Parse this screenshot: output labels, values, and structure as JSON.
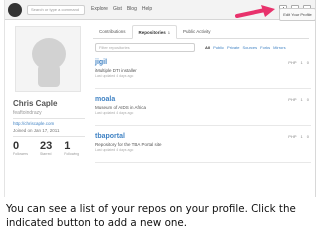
{
  "header": {
    "search_placeholder": "Search or type a command",
    "nav": [
      "Explore",
      "Gist",
      "Blog",
      "Help"
    ],
    "callout_label": "Edit Your Profile"
  },
  "profile": {
    "name": "Chris Caple",
    "username": "feaftoindrazy",
    "website": "http://chriscaple.com",
    "joined": "Joined on Jan 17, 2011",
    "stats": [
      {
        "value": "0",
        "label": "Followers"
      },
      {
        "value": "23",
        "label": "Starred"
      },
      {
        "value": "1",
        "label": "Following"
      }
    ]
  },
  "tabs": [
    {
      "label": "Contributions",
      "count": ""
    },
    {
      "label": "Repositories",
      "count": "1"
    },
    {
      "label": "Public Activity",
      "count": ""
    }
  ],
  "filter": {
    "placeholder": "Filter repositories",
    "types": [
      "All",
      "Public",
      "Private",
      "Sources",
      "Forks",
      "Mirrors"
    ]
  },
  "repos": [
    {
      "name": "jigil",
      "desc": "iMultiple DTI installer",
      "updated": "Last updated 4 days ago",
      "lang": "PHP",
      "stars": "1",
      "forks": "0"
    },
    {
      "name": "moala",
      "desc": "Museum of AIDS in Africa",
      "updated": "Last updated 4 days ago",
      "lang": "PHP",
      "stars": "1",
      "forks": "0"
    },
    {
      "name": "tbaportal",
      "desc": "Repository for the TBA Portal site",
      "updated": "Last updated 4 days ago",
      "lang": "PHP",
      "stars": "1",
      "forks": "0"
    }
  ],
  "caption": {
    "line1": "You can see a list of your repos on your profile. Click the",
    "line2": "indicated button to add a new one."
  },
  "colors": {
    "arrow": "#e8326c",
    "link": "#4183c4"
  }
}
